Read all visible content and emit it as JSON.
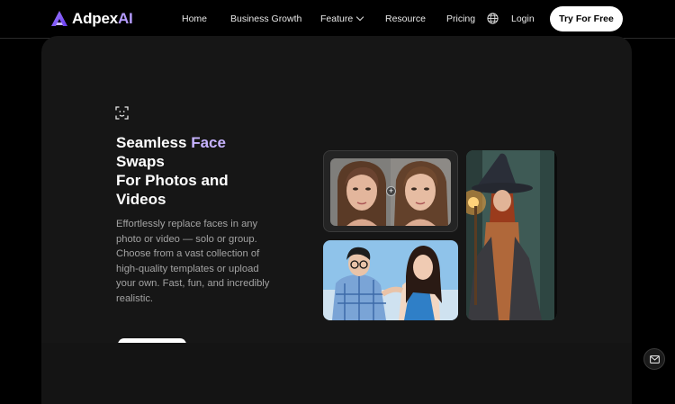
{
  "nav": {
    "brand_main": "Adpex",
    "brand_ai": "AI",
    "links": [
      "Home",
      "Business Growth",
      "Feature",
      "Resource",
      "Pricing"
    ],
    "login": "Login",
    "cta": "Try For Free"
  },
  "hero": {
    "title_part1": "Seamless ",
    "title_accent": "Face",
    "title_line2": "Swaps",
    "title_line3": "For Photos and",
    "title_line4": "Videos",
    "description": "Effortlessly replace faces in any photo or video — solo or group. Choose from a vast collection of high-quality templates or upload your own. Fast, fun, and incredibly realistic."
  },
  "icons": {
    "logo": "adpex-logo-icon",
    "feature": "face-scan-icon",
    "language": "globe-icon",
    "dropdown": "chevron-down-icon",
    "swap": "plus-icon",
    "contact": "mail-icon"
  },
  "colors": {
    "accent": "#c7b3ff",
    "brand_ai": "#b59cff",
    "background": "#000000",
    "card": "#161616"
  }
}
